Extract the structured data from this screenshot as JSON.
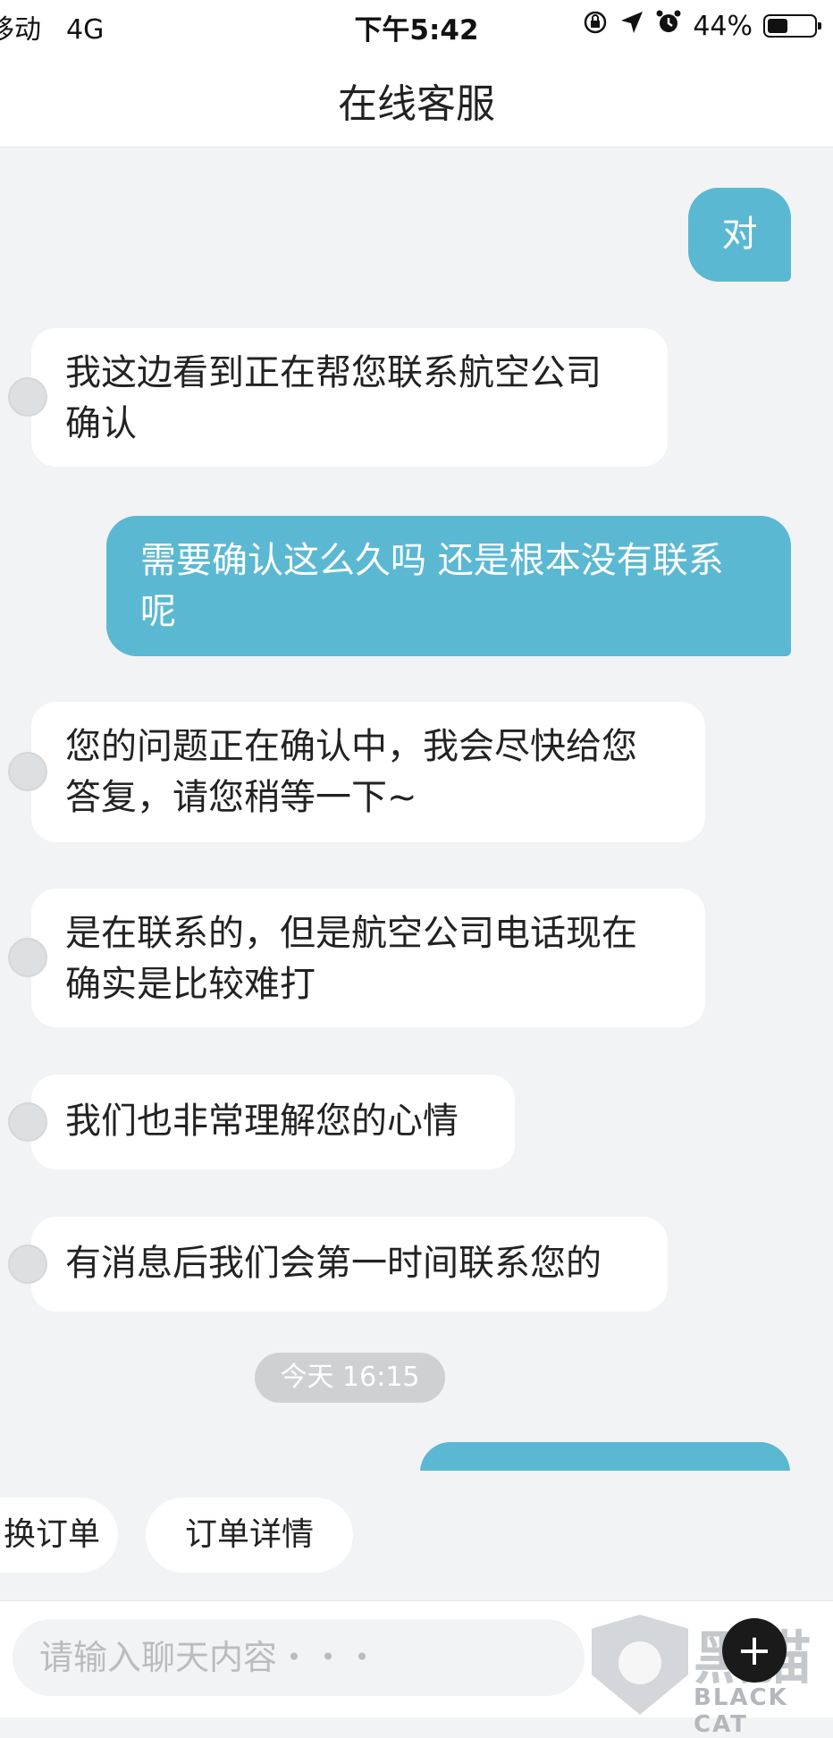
{
  "status_bar": {
    "carrier": "移动",
    "network": "4G",
    "time": "下午5:42",
    "battery": "44%",
    "battery_level": 0.44,
    "icons": [
      "orientation-lock-icon",
      "location-icon",
      "alarm-icon",
      "battery-icon"
    ]
  },
  "nav": {
    "title": "在线客服"
  },
  "messages": [
    {
      "from": "user",
      "text": "对"
    },
    {
      "from": "agent",
      "text": "我这边看到正在帮您联系航空公司确认"
    },
    {
      "from": "user",
      "text": "需要确认这么久吗 还是根本没有联系呢"
    },
    {
      "from": "agent",
      "text": "您的问题正在确认中，我会尽快给您答复，请您稍等一下~"
    },
    {
      "from": "agent",
      "text": "是在联系的，但是航空公司电话现在确实是比较难打"
    },
    {
      "from": "agent",
      "text": "我们也非常理解您的心情"
    },
    {
      "from": "agent",
      "text": "有消息后我们会第一时间联系您的"
    }
  ],
  "timestamp": "今天 16:15",
  "quick_replies": [
    "换订单",
    "订单详情"
  ],
  "input": {
    "placeholder": "请输入聊天内容・・・"
  },
  "watermark": {
    "cn": "黑猫",
    "en": "BLACK CAT"
  },
  "colors": {
    "user_bubble": "#5bb8d3",
    "agent_bubble": "#ffffff",
    "background": "#f2f3f5"
  }
}
